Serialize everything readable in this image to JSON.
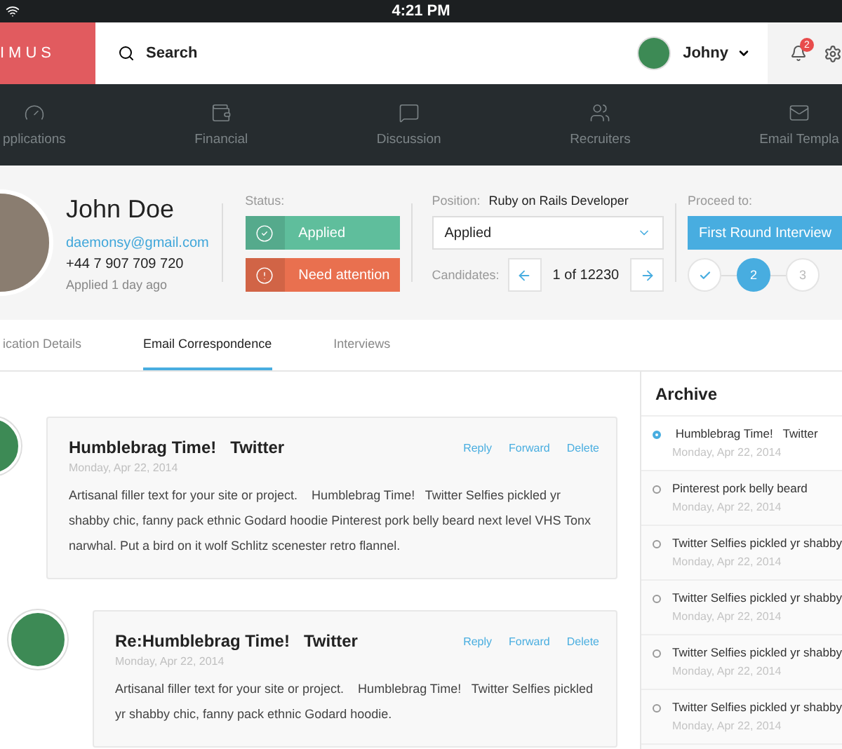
{
  "status_bar": {
    "time": "4:21 PM"
  },
  "header": {
    "logo": "IMUS",
    "search": {
      "placeholder": "Search"
    },
    "user": {
      "name": "Johny"
    },
    "notifications": {
      "count": "2"
    }
  },
  "nav": [
    {
      "label": "pplications"
    },
    {
      "label": "Financial"
    },
    {
      "label": "Discussion"
    },
    {
      "label": "Recruiters"
    },
    {
      "label": "Email Templa"
    }
  ],
  "profile": {
    "name": "John Doe",
    "email": "daemonsy@gmail.com",
    "phone": "+44 7 907 709 720",
    "applied": "Applied 1 day ago"
  },
  "status": {
    "label": "Status:",
    "items": [
      {
        "kind": "ok",
        "label": "Applied"
      },
      {
        "kind": "warning",
        "label": "Need attention"
      }
    ]
  },
  "position": {
    "label": "Position:",
    "value": "Ruby on Rails Developer",
    "select": "Applied",
    "candidates_label": "Candidates:",
    "counter": "1 of 12230"
  },
  "proceed": {
    "label": "Proceed to:",
    "button": "First Round Interview",
    "steps": [
      {
        "kind": "done"
      },
      {
        "kind": "current",
        "label": "2"
      },
      {
        "kind": "pending",
        "label": "3"
      }
    ]
  },
  "tabs": [
    {
      "label": "ication Details",
      "selected": false
    },
    {
      "label": "Email Correspondence",
      "selected": true
    },
    {
      "label": "Interviews",
      "selected": false
    }
  ],
  "messages": [
    {
      "title": "Humblebrag Time!   Twitter",
      "date": "Monday, Apr 22, 2014",
      "actions": [
        "Reply",
        "Forward",
        "Delete"
      ],
      "body": "Artisanal filler text for your site or project.    Humblebrag Time!   Twitter Selfies pickled yr shabby chic, fanny pack ethnic Godard hoodie Pinterest pork belly beard next level VHS Tonx narwhal. Put a bird on it wolf Schlitz scenester retro flannel.",
      "replies": [
        {
          "title": "Re:Humblebrag Time!   Twitter",
          "date": "Monday, Apr 22, 2014",
          "actions": [
            "Reply",
            "Forward",
            "Delete"
          ],
          "body": "Artisanal filler text for your site or project.    Humblebrag Time!   Twitter Selfies pickled yr shabby chic, fanny pack ethnic Godard hoodie."
        }
      ]
    }
  ],
  "archive": {
    "title": "Archive",
    "items": [
      {
        "title": " Humblebrag Time!   Twitter",
        "date": "Monday, Apr 22, 2014",
        "selected": true
      },
      {
        "title": "Pinterest pork belly beard",
        "date": "Monday, Apr 22, 2014",
        "selected": false
      },
      {
        "title": "Twitter Selfies pickled yr shabby",
        "date": "Monday, Apr 22, 2014",
        "selected": false
      },
      {
        "title": "Twitter Selfies pickled yr shabby",
        "date": "Monday, Apr 22, 2014",
        "selected": false
      },
      {
        "title": "Twitter Selfies pickled yr shabby",
        "date": "Monday, Apr 22, 2014",
        "selected": false
      },
      {
        "title": "Twitter Selfies pickled yr shabby",
        "date": "Monday, Apr 22, 2014",
        "selected": false
      }
    ]
  }
}
